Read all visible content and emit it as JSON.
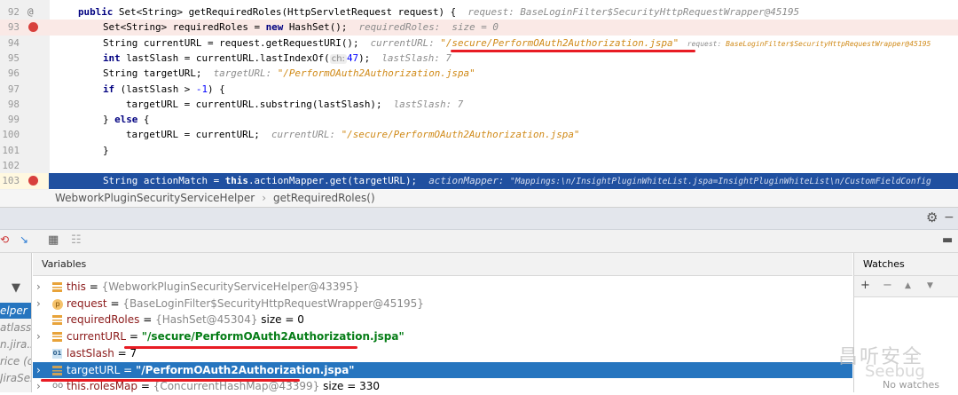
{
  "editor": {
    "lines": [
      {
        "n": "92",
        "marker": "@"
      },
      {
        "n": "93",
        "marker": "breakpoint"
      },
      {
        "n": "94"
      },
      {
        "n": "95"
      },
      {
        "n": "96"
      },
      {
        "n": "97"
      },
      {
        "n": "98"
      },
      {
        "n": "99"
      },
      {
        "n": "100"
      },
      {
        "n": "101"
      },
      {
        "n": "102"
      },
      {
        "n": "103",
        "marker": "breakpoint"
      }
    ],
    "t": {
      "l92a": "public",
      "l92b": " Set<String> getRequiredRoles(HttpServletRequest request) {",
      "l92h": "request: BaseLoginFilter$SecurityHttpRequestWrapper@45195",
      "l93a": "Set<String> requiredRoles = ",
      "l93k": "new",
      "l93b": " HashSet();",
      "l93h": "requiredRoles:  size = 0",
      "l94a": "String currentURL = request.getRequestURI();",
      "l94h": "currentURL: ",
      "l94s": "\"/secure/PerformOAuth2Authorization.jspa\"",
      "l94h2": "request: ",
      "l94s2": "BaseLoginFilter$SecurityHttpRequestWrapper@45195",
      "l95k": "int",
      "l95a": " lastSlash = currentURL.lastIndexOf(",
      "l95c": "ch:",
      "l95n": "47",
      "l95b": ");",
      "l95h": "lastSlash: 7",
      "l96a": "String targetURL;",
      "l96h": "targetURL: ",
      "l96s": "\"/PerformOAuth2Authorization.jspa\"",
      "l97k": "if",
      "l97a": " (lastSlash > ",
      "l97n": "-1",
      "l97b": ") {",
      "l98a": "targetURL = currentURL.substring(lastSlash);",
      "l98h": "lastSlash: 7",
      "l99a": "} ",
      "l99k": "else",
      "l99b": " {",
      "l100a": "targetURL = currentURL;",
      "l100h": "currentURL: ",
      "l100s": "\"/secure/PerformOAuth2Authorization.jspa\"",
      "l101a": "}",
      "l103a": "String actionMatch = ",
      "l103k": "this",
      "l103b": ".actionMapper.get(targetURL);",
      "l103h": "actionMapper: ",
      "l103s": "\"Mappings:\\n/InsightPluginWhiteList.jspa=InsightPluginWhiteList\\n/CustomFieldConfig"
    }
  },
  "breadcrumb": [
    "WebworkPluginSecurityServiceHelper",
    "getRequiredRoles()"
  ],
  "frames": [
    "elper (c",
    "atlassia",
    "n.jira.se",
    "rice (co",
    "JiraSer"
  ],
  "variables": {
    "title": "Variables",
    "rows": [
      {
        "name": "this",
        "eq": " = ",
        "ref": "{WebworkPluginSecurityServiceHelper@43395}",
        "extra": ""
      },
      {
        "name": "request",
        "eq": " = ",
        "ref": "{BaseLoginFilter$SecurityHttpRequestWrapper@45195}",
        "extra": ""
      },
      {
        "name": "requiredRoles",
        "eq": " = ",
        "ref": "{HashSet@45304}",
        "extra": "  size = 0"
      },
      {
        "name": "currentURL",
        "eq": " = ",
        "str": "\"/secure/PerformOAuth2Authorization.jspa\""
      },
      {
        "name": "lastSlash",
        "eq": " = ",
        "val": "7"
      },
      {
        "name": "targetURL",
        "eq": " = ",
        "str": "\"/PerformOAuth2Authorization.jspa\""
      },
      {
        "name": "this.rolesMap",
        "eq": " = ",
        "ref": "{ConcurrentHashMap@43399}",
        "extra": "  size = 330"
      }
    ]
  },
  "watches": {
    "title": "Watches",
    "empty": "No watches",
    "add": "+",
    "remove": "−",
    "up": "▲",
    "down": "▼"
  },
  "watermark": {
    "text": "昌听安全",
    "brand": "Seebug"
  }
}
